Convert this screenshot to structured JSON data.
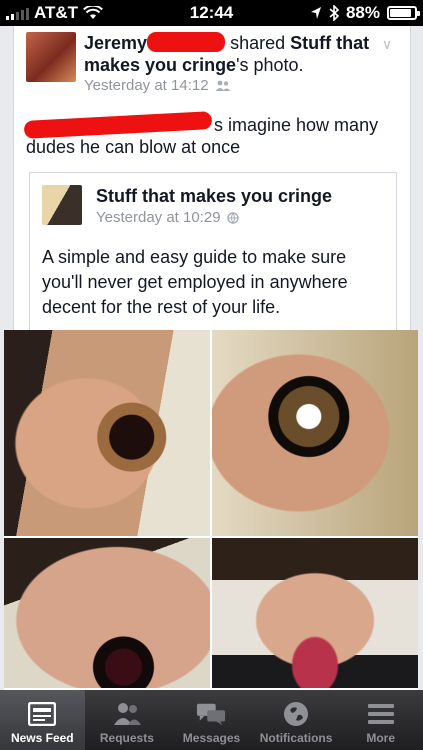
{
  "status_bar": {
    "carrier": "AT&T",
    "time": "12:44",
    "battery_label": "88%",
    "battery_level": 0.88
  },
  "post": {
    "author_first": "Jeremy",
    "action": "shared",
    "shared_from": "Stuff that makes you cringe",
    "shared_suffix": "'s photo.",
    "timestamp": "Yesterday at 14:12",
    "status_tail": "s imagine how many dudes he can blow at once",
    "shared_post": {
      "page_name": "Stuff that makes you cringe",
      "timestamp": "Yesterday at 10:29",
      "text": "A simple and easy guide to make sure you'll never get employed in anywhere decent for the rest of your life."
    }
  },
  "tabbar": {
    "tabs": [
      {
        "label": "News Feed",
        "icon": "news-feed-icon",
        "active": true
      },
      {
        "label": "Requests",
        "icon": "requests-icon",
        "active": false
      },
      {
        "label": "Messages",
        "icon": "messages-icon",
        "active": false
      },
      {
        "label": "Notifications",
        "icon": "notifications-icon",
        "active": false
      },
      {
        "label": "More",
        "icon": "more-icon",
        "active": false
      }
    ]
  },
  "colors": {
    "redaction": "#ee1111",
    "meta_gray": "#90949c",
    "tabbar_dark": "#1e1e20"
  }
}
